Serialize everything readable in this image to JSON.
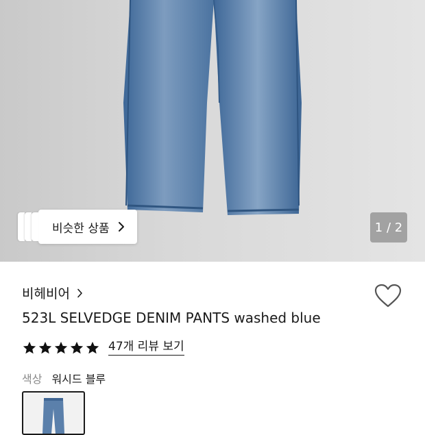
{
  "gallery": {
    "similar_products_label": "비슷한 상품",
    "page_indicator": "1 / 2"
  },
  "product": {
    "brand": "비헤비어",
    "name": "523L SELVEDGE DENIM PANTS washed blue",
    "rating": 5,
    "review_link": "47개 리뷰 보기",
    "color_label": "색상",
    "color_value": "워시드 블루"
  },
  "colors": {
    "text": "#1a1a1a",
    "muted": "#8a8a8a",
    "denim": "#4a6f9c"
  }
}
